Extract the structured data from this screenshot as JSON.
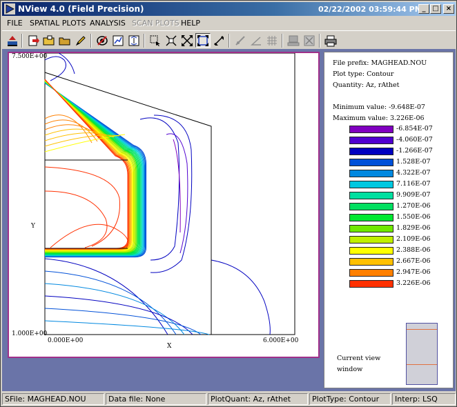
{
  "window": {
    "title": "NView 4.0 (Field Precision)",
    "datetime": "02/22/2002 03:59:44 PM",
    "controls": [
      "minimize",
      "maximize",
      "close"
    ]
  },
  "menu": {
    "items": [
      {
        "label": "FILE",
        "enabled": true
      },
      {
        "label": "SPATIAL PLOTS",
        "enabled": true
      },
      {
        "label": "ANALYSIS",
        "enabled": true
      },
      {
        "label": "SCAN PLOTS",
        "enabled": false
      },
      {
        "label": "HELP",
        "enabled": true
      }
    ]
  },
  "toolbar": {
    "icons": [
      "load-file-icon",
      "export-icon",
      "open-folder-icon",
      "folder-icon",
      "pencil-icon",
      "contour-icon",
      "line-plot-icon",
      "scan-icon",
      "zoom-window-icon",
      "zoom-cross-icon",
      "expand-icon",
      "fit-view-icon",
      "pan-icon",
      "field-line-icon",
      "angle-icon",
      "grid-icon",
      "computer-icon",
      "cancel-icon",
      "printer-icon"
    ]
  },
  "plot": {
    "y_top_label": "7.500E+00",
    "y_bottom_label": "1.000E+00",
    "x_left_label": "0.000E+00",
    "x_right_label": "6.000E+00",
    "x_axis_label": "X",
    "y_axis_label": "Y",
    "border_color": "#a0308a"
  },
  "info": {
    "file_prefix": "File prefix: MAGHEAD.NOU",
    "plot_type": "Plot type: Contour",
    "quantity": "Quantity: Az, rAthet",
    "min_value": "Minimum value:  -9.648E-07",
    "max_value": "Maximum value:   3.226E-06",
    "legend": [
      {
        "color": "#8000c0",
        "label": "-6.854E-07"
      },
      {
        "color": "#5000d0",
        "label": "-4.060E-07"
      },
      {
        "color": "#0000c0",
        "label": "-1.266E-07"
      },
      {
        "color": "#0050d8",
        "label": "1.528E-07"
      },
      {
        "color": "#0088e0",
        "label": "4.322E-07"
      },
      {
        "color": "#00c8e0",
        "label": "7.116E-07"
      },
      {
        "color": "#00e0a0",
        "label": "9.909E-07"
      },
      {
        "color": "#00e060",
        "label": "1.270E-06"
      },
      {
        "color": "#00e830",
        "label": "1.550E-06"
      },
      {
        "color": "#70e800",
        "label": "1.829E-06"
      },
      {
        "color": "#c0f000",
        "label": "2.109E-06"
      },
      {
        "color": "#ffff00",
        "label": "2.388E-06"
      },
      {
        "color": "#ffc000",
        "label": "2.667E-06"
      },
      {
        "color": "#ff8000",
        "label": "2.947E-06"
      },
      {
        "color": "#ff3000",
        "label": "3.226E-06"
      }
    ],
    "view_label_1": "Current view",
    "view_label_2": "window"
  },
  "status": {
    "sfile": "SFile: MAGHEAD.NOU",
    "data_file": "Data file: None",
    "plot_quant": "PlotQuant: Az, rAthet",
    "plot_type": "PlotType: Contour",
    "interp": "Interp: LSQ"
  }
}
